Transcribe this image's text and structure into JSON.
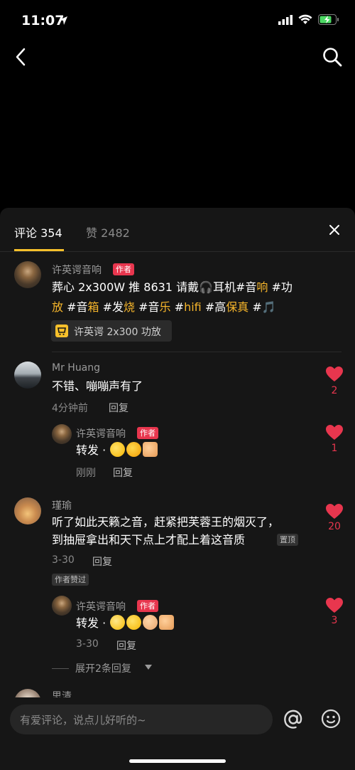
{
  "status_bar": {
    "time": "11:07"
  },
  "tabs": {
    "comments": "评论 354",
    "likes": "赞 2482"
  },
  "comments": [
    {
      "user": "许英谔音响",
      "badge": "作者",
      "text_lines": [
        [
          [
            "葬心 2x300W 推 8631 请戴",
            ""
          ],
          [
            "🎧",
            ""
          ],
          [
            "耳机#音",
            ""
          ],
          [
            "响",
            "hl"
          ],
          [
            " #功",
            ""
          ]
        ],
        [
          [
            "放",
            "hl"
          ],
          [
            " #音",
            ""
          ],
          [
            "箱",
            "hl"
          ],
          [
            " #发",
            ""
          ],
          [
            "烧",
            "hl"
          ],
          [
            " #音",
            ""
          ],
          [
            "乐",
            "hl"
          ],
          [
            " #",
            ""
          ],
          [
            "hifi",
            "hl"
          ],
          [
            " #高",
            ""
          ],
          [
            "保真",
            "hl"
          ],
          [
            " #",
            ""
          ],
          [
            "🎵",
            ""
          ]
        ]
      ],
      "product": "许英谔 2x300 功放"
    },
    {
      "user": "Mr Huang",
      "text": "不错、嘣嘣声有了",
      "time": "4分钟前",
      "reply_label": "回复",
      "likes": "2",
      "reply": {
        "user": "许英谔音响",
        "badge": "作者",
        "text": "转发 · ",
        "time": "刚刚",
        "reply_label": "回复",
        "likes": "1"
      }
    },
    {
      "user": "瑾瑜",
      "text_line1": "听了如此天籁之音，赶紧把芙蓉王的烟灭了，",
      "text_line2": "到抽屉拿出和天下点上才配上着这音质",
      "pinned": "置顶",
      "time": "3-30",
      "reply_label": "回复",
      "author_liked": "作者赞过",
      "likes": "20",
      "reply": {
        "user": "许英谔音响",
        "badge": "作者",
        "text": "转发 · ",
        "time": "3-30",
        "reply_label": "回复",
        "likes": "3"
      },
      "expand": "展开2条回复"
    },
    {
      "user": "思清"
    }
  ],
  "input": {
    "placeholder": "有爱评论，说点儿好听的~"
  },
  "colors": {
    "accent": "#f7c02b",
    "like": "#e8364e",
    "badge": "#e8364e",
    "sheet_bg": "#161616"
  }
}
